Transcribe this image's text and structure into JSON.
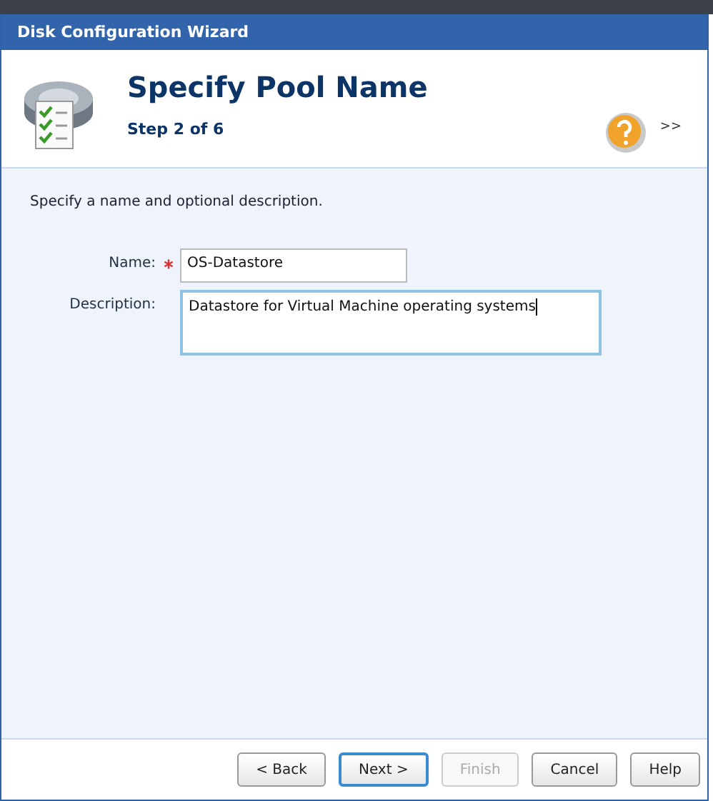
{
  "window": {
    "title": "Disk Configuration Wizard"
  },
  "header": {
    "title": "Specify Pool Name",
    "step": "Step 2 of 6",
    "more": ">>"
  },
  "instructions": "Specify a name and optional description.",
  "fields": [
    {
      "kind": "input",
      "label": "Name:",
      "required": true,
      "value": "OS-Datastore",
      "focused": false
    },
    {
      "kind": "textarea",
      "label": "Description:",
      "required": false,
      "value": "Datastore for Virtual Machine operating systems",
      "focused": true
    }
  ],
  "buttons": [
    {
      "label": "< Back",
      "disabled": false,
      "focused": false
    },
    {
      "label": "Next >",
      "disabled": false,
      "focused": true
    },
    {
      "label": "Finish",
      "disabled": true,
      "focused": false
    },
    {
      "label": "Cancel",
      "disabled": false,
      "focused": false
    },
    {
      "label": "Help",
      "disabled": false,
      "focused": false
    }
  ]
}
